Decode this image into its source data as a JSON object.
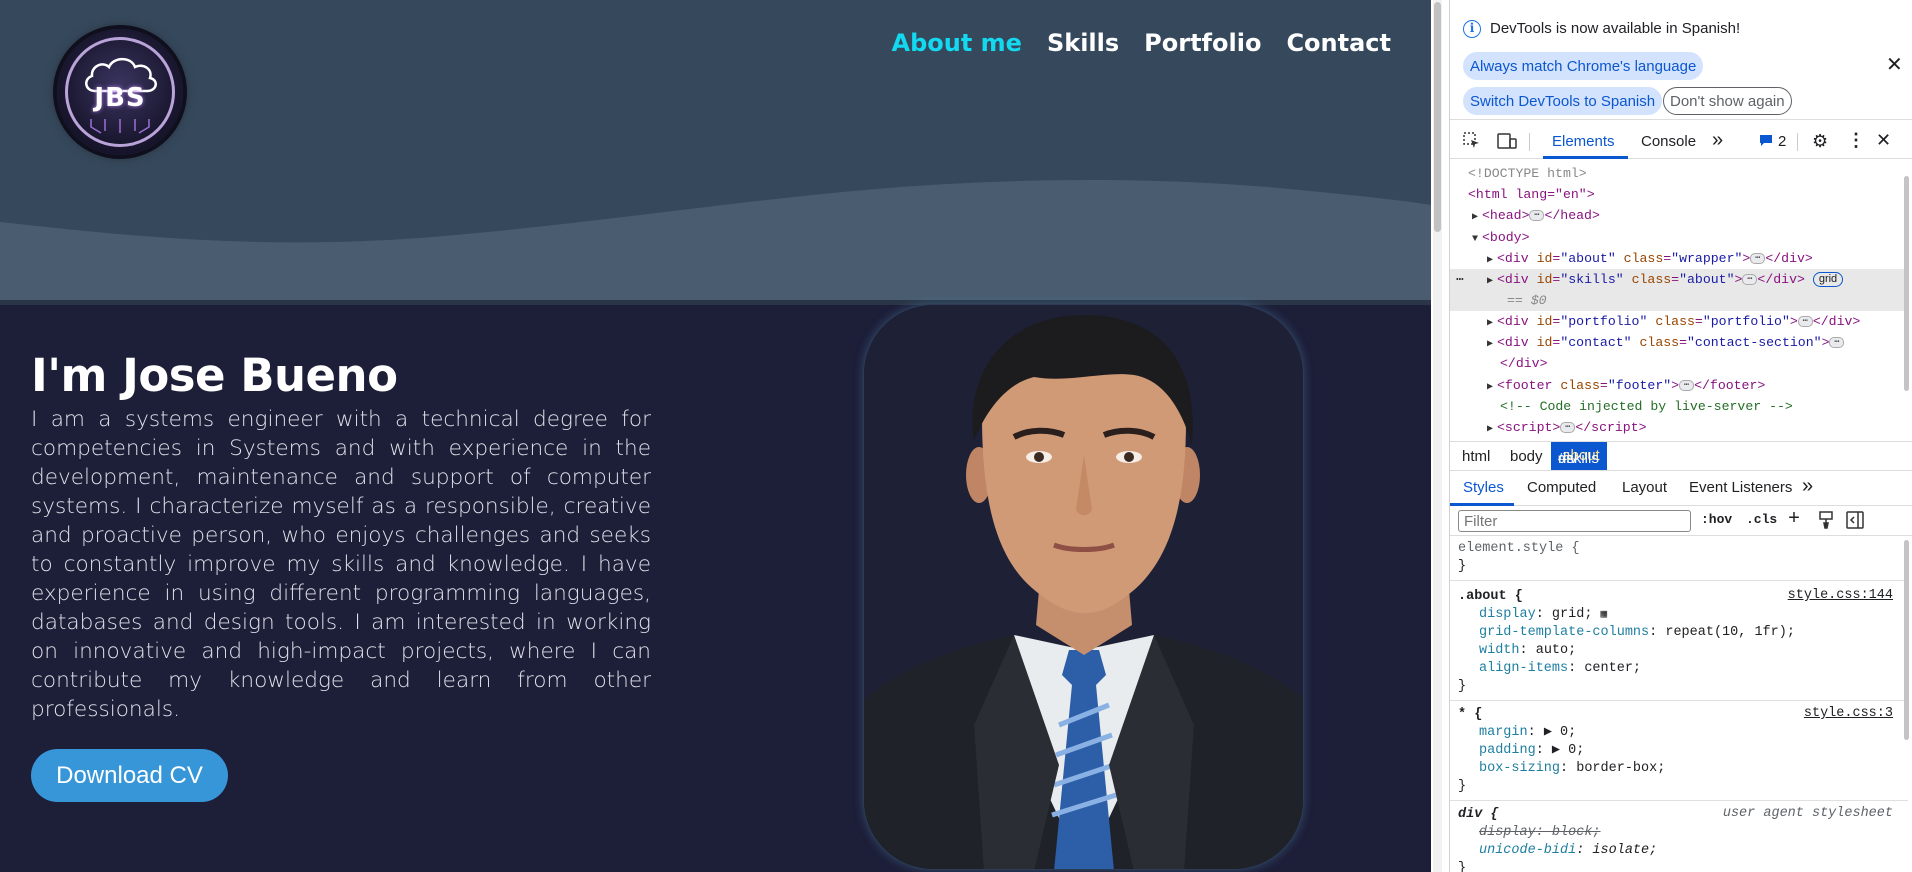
{
  "site": {
    "logo_text": "JBS",
    "nav": [
      {
        "label": "About me",
        "active": true
      },
      {
        "label": "Skills",
        "active": false
      },
      {
        "label": "Portfolio",
        "active": false
      },
      {
        "label": "Contact",
        "active": false
      }
    ],
    "about_title": "I'm Jose Bueno",
    "about_text": "I am a systems engineer with a technical degree for competencies in Systems and with experience in the development, maintenance and support of computer systems. I characterize myself as a responsible, creative and proactive person, who enjoys challenges and seeks to constantly improve my skills and knowledge. I have experience in using different programming languages, databases and design tools. I am interested in working on innovative and high-impact projects, where I can contribute my knowledge and learn from other professionals.",
    "cv_button": "Download CV",
    "colors": {
      "hero_bg": "#36495c",
      "body_bg": "#1d1e38",
      "nav_active": "#12d8f0",
      "button": "#3796d8"
    }
  },
  "devtools": {
    "infobar": {
      "message": "DevTools is now available in Spanish!",
      "btn_match": "Always match Chrome's language",
      "btn_switch": "Switch DevTools to Spanish",
      "btn_dont": "Don't show again",
      "info_icon": "info-icon",
      "close_icon": "close-icon"
    },
    "toolbar": {
      "tabs": [
        "Elements",
        "Console"
      ],
      "active_tab": "Elements",
      "more": "»",
      "issues_count": "2"
    },
    "dom": {
      "doctype": "<!DOCTYPE html>",
      "html_open": "<html lang=\"en\">",
      "head": {
        "open": "<head>",
        "close": "</head>"
      },
      "body_open": "<body>",
      "nodes": [
        {
          "tag": "div",
          "id": "about",
          "class": "wrapper"
        },
        {
          "tag": "div",
          "id": "skills",
          "class": "about",
          "badge": "grid",
          "selected": true,
          "note": "== $0"
        },
        {
          "tag": "div",
          "id": "portfolio",
          "class": "portfolio"
        },
        {
          "tag": "div",
          "id": "contact",
          "class": "contact-section"
        }
      ],
      "footer": "footer",
      "footer_class": "footer",
      "comment": "<!-- Code injected by live-server -->",
      "script": "script",
      "close_div": "</div>"
    },
    "breadcrumbs": [
      "html",
      "body"
    ],
    "breadcrumb_current": {
      "tag": "div",
      "rest": "#skills",
      "cls": ".about"
    },
    "style_tabs": [
      "Styles",
      "Computed",
      "Layout",
      "Event Listeners",
      "»"
    ],
    "filter_placeholder": "Filter",
    "filter_tools": [
      ":hov",
      ".cls",
      "+"
    ],
    "rules": {
      "element_style": "element.style {",
      "about": {
        "selector": ".about {",
        "source": "style.css:144",
        "props": [
          {
            "name": "display",
            "value": "grid;"
          },
          {
            "name": "grid-template-columns",
            "value": "repeat(10, 1fr);"
          },
          {
            "name": "width",
            "value": "auto;"
          },
          {
            "name": "align-items",
            "value": "center;"
          }
        ]
      },
      "universal": {
        "selector": "* {",
        "source": "style.css:3",
        "props": [
          {
            "name": "margin",
            "value": "▶ 0;"
          },
          {
            "name": "padding",
            "value": "▶ 0;"
          },
          {
            "name": "box-sizing",
            "value": "border-box;"
          }
        ]
      },
      "div_ua": {
        "selector": "div {",
        "source": "user agent stylesheet",
        "props": [
          {
            "name": "display",
            "value": "block;"
          },
          {
            "name": "unicode-bidi",
            "value": "isolate;"
          }
        ]
      },
      "close": "}"
    }
  }
}
